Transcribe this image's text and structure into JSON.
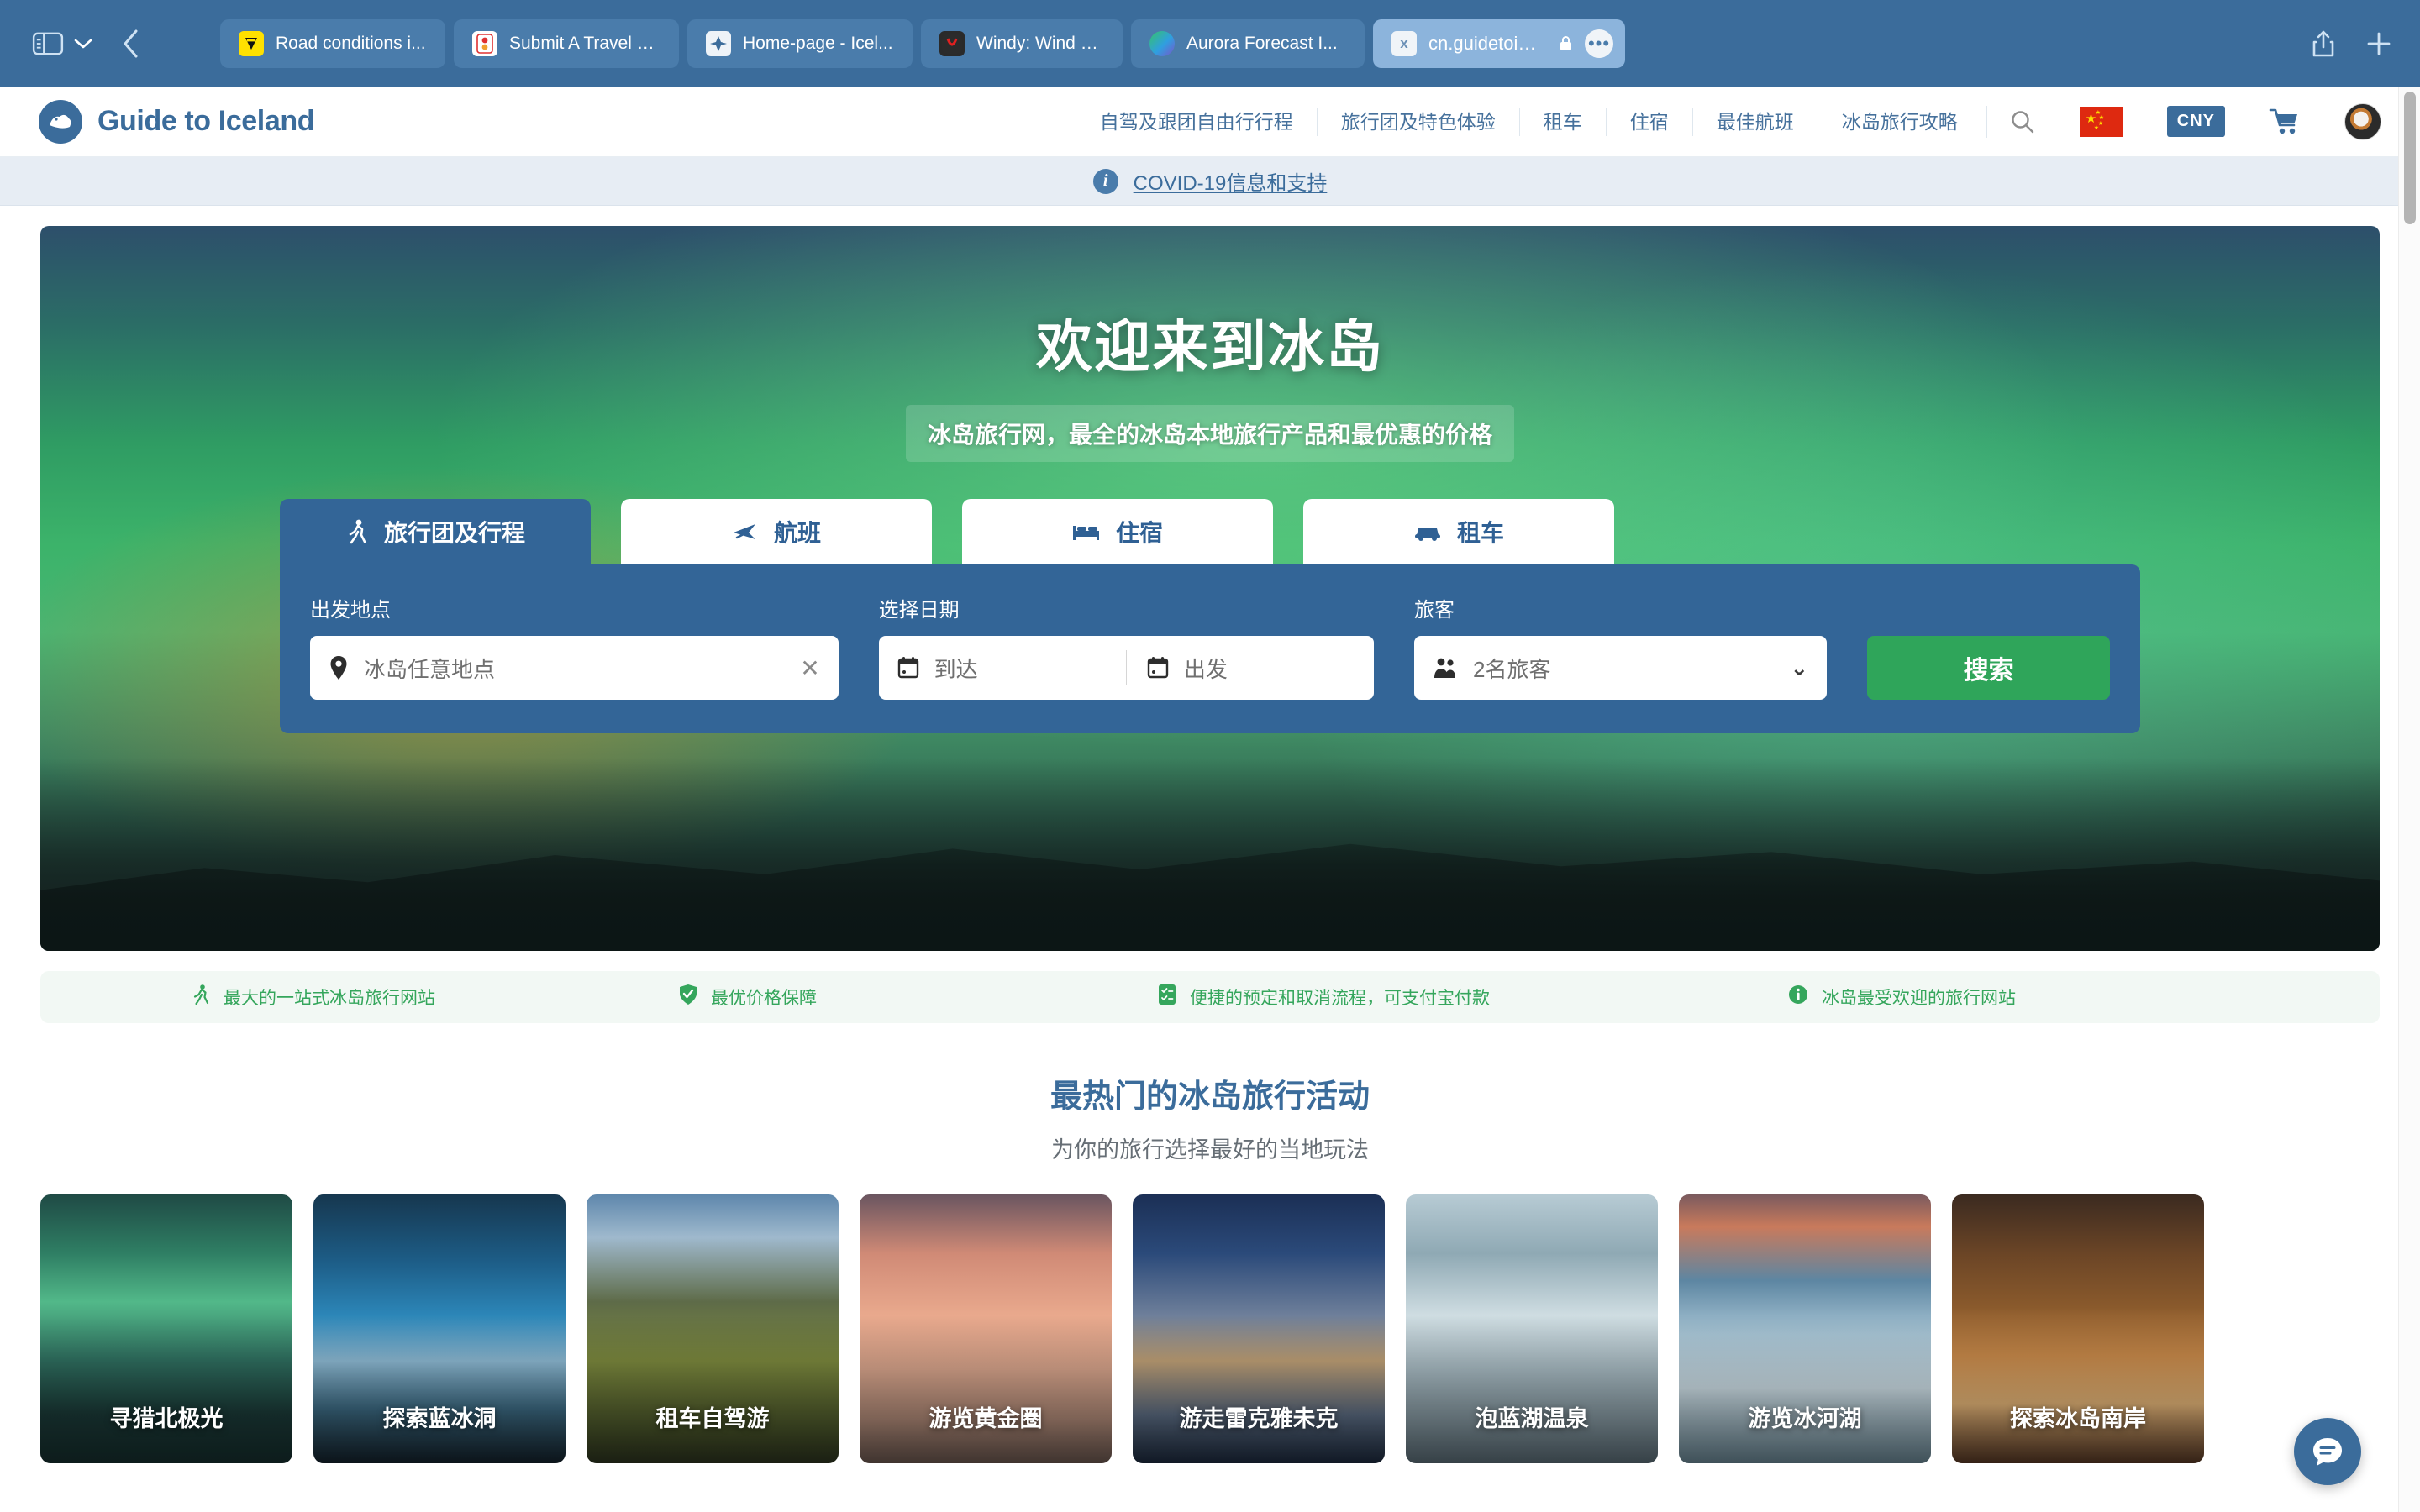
{
  "browser": {
    "sidebar_toggle": "sidebar-toggle",
    "tabs": [
      {
        "title": "Road conditions i...",
        "favicon": "road-conditions-favicon",
        "active": false
      },
      {
        "title": "Submit A Travel P...",
        "favicon": "travel-form-favicon",
        "active": false
      },
      {
        "title": "Home-page - Icel...",
        "favicon": "home-page-favicon",
        "active": false
      },
      {
        "title": "Windy: Wind map...",
        "favicon": "windy-favicon",
        "active": false
      },
      {
        "title": "Aurora Forecast I...",
        "favicon": "aurora-favicon",
        "active": false
      },
      {
        "title": "cn.guidetoiceland.is",
        "favicon": "guidetoiceland-favicon",
        "active": true
      }
    ],
    "more_label": "•••",
    "share_label": "share",
    "new_tab_label": "+"
  },
  "site_header": {
    "brand": "Guide to Iceland",
    "nav": [
      "自驾及跟团自由行行程",
      "旅行团及特色体验",
      "租车",
      "住宿",
      "最佳航班",
      "冰岛旅行攻略"
    ],
    "currency": "CNY",
    "language": "中文",
    "search_label": "搜索",
    "cart_label": "购物车",
    "account_label": "账户"
  },
  "covid_banner": {
    "icon": "i",
    "link_text": "COVID-19信息和支持"
  },
  "hero": {
    "title": "欢迎来到冰岛",
    "subtitle": "冰岛旅行网，最全的冰岛本地旅行产品和最优惠的价格",
    "tabs": [
      {
        "label": "旅行团及行程",
        "icon": "hiker-icon",
        "active": true
      },
      {
        "label": "航班",
        "icon": "plane-icon",
        "active": false
      },
      {
        "label": "住宿",
        "icon": "bed-icon",
        "active": false
      },
      {
        "label": "租车",
        "icon": "car-icon",
        "active": false
      }
    ],
    "form": {
      "place_label": "出发地点",
      "place_value": "冰岛任意地点",
      "place_clear": "✕",
      "date_label": "选择日期",
      "date_arrival": "到达",
      "date_departure": "出发",
      "pax_label": "旅客",
      "pax_value": "2名旅客",
      "search_button": "搜索"
    }
  },
  "benefits": [
    {
      "icon": "hiker-icon",
      "text": "最大的一站式冰岛旅行网站"
    },
    {
      "icon": "shield-check-icon",
      "text": "最优价格保障"
    },
    {
      "icon": "checklist-icon",
      "text": "便捷的预定和取消流程，可支付宝付款"
    },
    {
      "icon": "info-icon",
      "text": "冰岛最受欢迎的旅行网站"
    }
  ],
  "section": {
    "title": "最热门的冰岛旅行活动",
    "subtitle": "为你的旅行选择最好的当地玩法"
  },
  "activity_cards": [
    {
      "label": "寻猎北极光"
    },
    {
      "label": "探索蓝冰洞"
    },
    {
      "label": "租车自驾游"
    },
    {
      "label": "游览黄金圈"
    },
    {
      "label": "游走雷克雅未克"
    },
    {
      "label": "泡蓝湖温泉"
    },
    {
      "label": "游览冰河湖"
    },
    {
      "label": "探索冰岛南岸"
    }
  ],
  "chat": {
    "label": "在线客服"
  },
  "colors": {
    "chrome": "#3b6c9b",
    "brand_blue": "#3b6c9b",
    "search_panel": "#336597",
    "search_button_green": "#2fa55a",
    "benefit_green": "#35a65c",
    "covid_bg": "#e7edf4"
  }
}
